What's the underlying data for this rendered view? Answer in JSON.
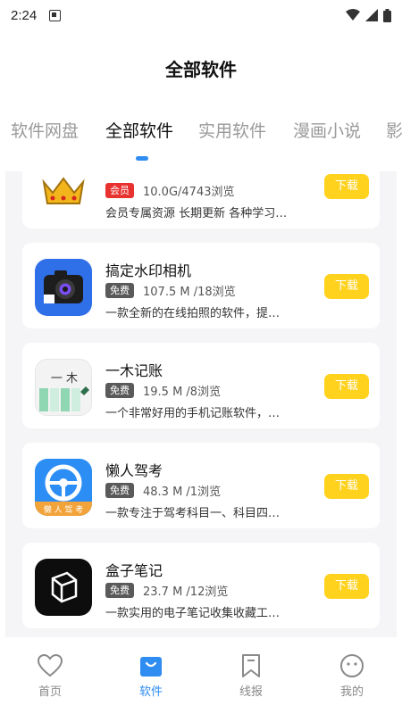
{
  "status": {
    "time": "2:24"
  },
  "page_title": "全部软件",
  "tabs": [
    {
      "label": "软件网盘"
    },
    {
      "label": "全部软件",
      "active": true
    },
    {
      "label": "实用软件"
    },
    {
      "label": "漫画小说"
    },
    {
      "label": "影"
    }
  ],
  "apps": [
    {
      "name": "",
      "badge": "会员",
      "meta": "10.0G/4743浏览",
      "desc": "会员专属资源 长期更新 各种学习…",
      "button": "下载",
      "icon": "crown-icon"
    },
    {
      "name": "搞定水印相机",
      "badge": "免费",
      "meta": "107.5 M /18浏览",
      "desc": "一款全新的在线拍照的软件，提…",
      "button": "下载",
      "icon": "camera-icon"
    },
    {
      "name": "一木记账",
      "badge": "免费",
      "meta": "19.5 M /8浏览",
      "desc": "一个非常好用的手机记账软件，…",
      "button": "下载",
      "icon": "notebook-icon",
      "icon_text": "一 木"
    },
    {
      "name": "懒人驾考",
      "badge": "免费",
      "meta": "48.3 M /1浏览",
      "desc": "一款专注于驾考科目一、科目四…",
      "button": "下载",
      "icon": "steering-wheel-icon",
      "icon_text": "懒 人 驾 考"
    },
    {
      "name": "盒子笔记",
      "badge": "免费",
      "meta": "23.7 M /12浏览",
      "desc": "一款实用的电子笔记收集收藏工…",
      "button": "下载",
      "icon": "cube-icon"
    }
  ],
  "bottom_nav": [
    {
      "label": "首页",
      "icon": "heart-icon"
    },
    {
      "label": "软件",
      "icon": "bag-icon",
      "active": true
    },
    {
      "label": "线报",
      "icon": "bookmark-icon"
    },
    {
      "label": "我的",
      "icon": "smile-icon"
    }
  ],
  "colors": {
    "accent": "#2f8cf0",
    "download": "#ffd21e",
    "vip_badge": "#e8322f",
    "free_badge": "#5a5a5a"
  }
}
